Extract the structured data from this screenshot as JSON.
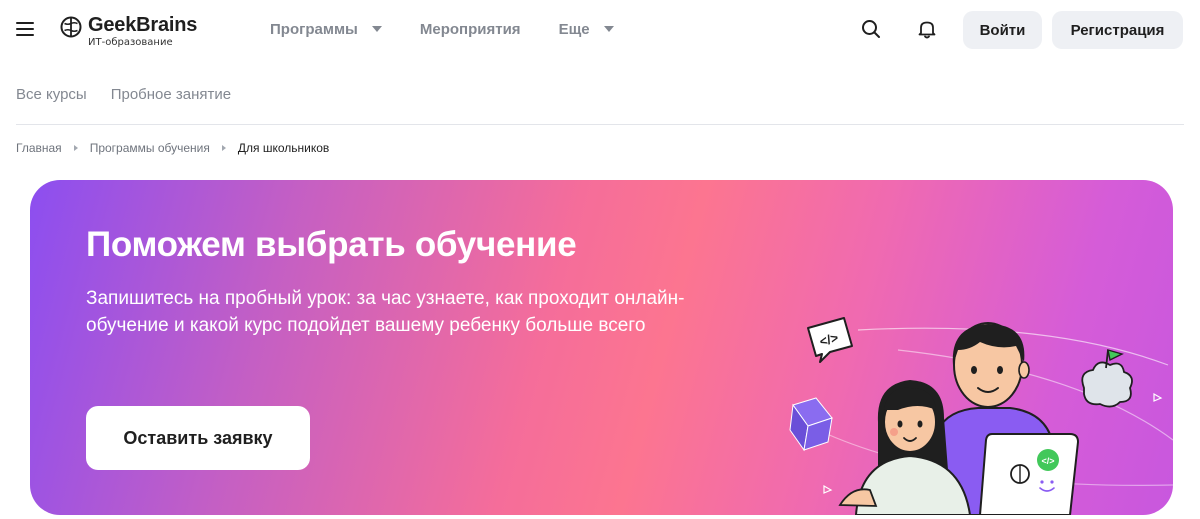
{
  "header": {
    "logo_name": "GeekBrains",
    "logo_tagline": "ИТ-образование",
    "nav": [
      {
        "label": "Программы",
        "has_dropdown": true
      },
      {
        "label": "Мероприятия",
        "has_dropdown": false
      },
      {
        "label": "Еще",
        "has_dropdown": true
      }
    ],
    "icons": [
      "menu-icon",
      "search-icon",
      "bell-icon"
    ],
    "login_label": "Войти",
    "register_label": "Регистрация"
  },
  "subnav": {
    "items": [
      "Все курсы",
      "Пробное занятие"
    ]
  },
  "breadcrumb": {
    "items": [
      "Главная",
      "Программы обучения",
      "Для школьников"
    ]
  },
  "banner": {
    "title": "Поможем выбрать обучение",
    "text": "Запишитесь на пробный урок: за час узнаете, как проходит онлайн-обучение и какой курс подойдет вашему ребенку больше всего",
    "cta_label": "Оставить заявку",
    "speech_bubble": "</>",
    "laptop_badge": "</>",
    "colors": {
      "gradient_start": "#8c4ef0",
      "gradient_mid": "#fc7590",
      "gradient_end": "#c857de",
      "button_bg": "#ffffff"
    }
  }
}
